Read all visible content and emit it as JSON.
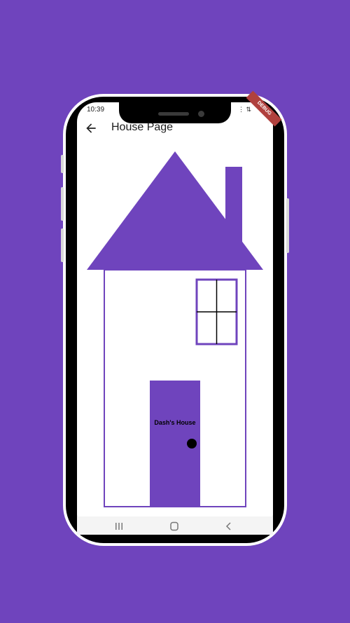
{
  "status_bar": {
    "time": "10:39",
    "icons": "◧ ▮",
    "signal": "⋮ ⇅"
  },
  "debug_banner": "DEBUG",
  "app_bar": {
    "title": "House Page",
    "back_icon": "arrow-back-icon"
  },
  "house": {
    "door_label": "Dash's House"
  },
  "colors": {
    "background": "#6f44bd",
    "accent": "#6f44bd",
    "screen": "#ffffff",
    "knob": "#000000"
  },
  "nav_bar": {
    "recents_icon": "recents-icon",
    "home_icon": "home-icon",
    "back_icon": "nav-back-icon"
  }
}
